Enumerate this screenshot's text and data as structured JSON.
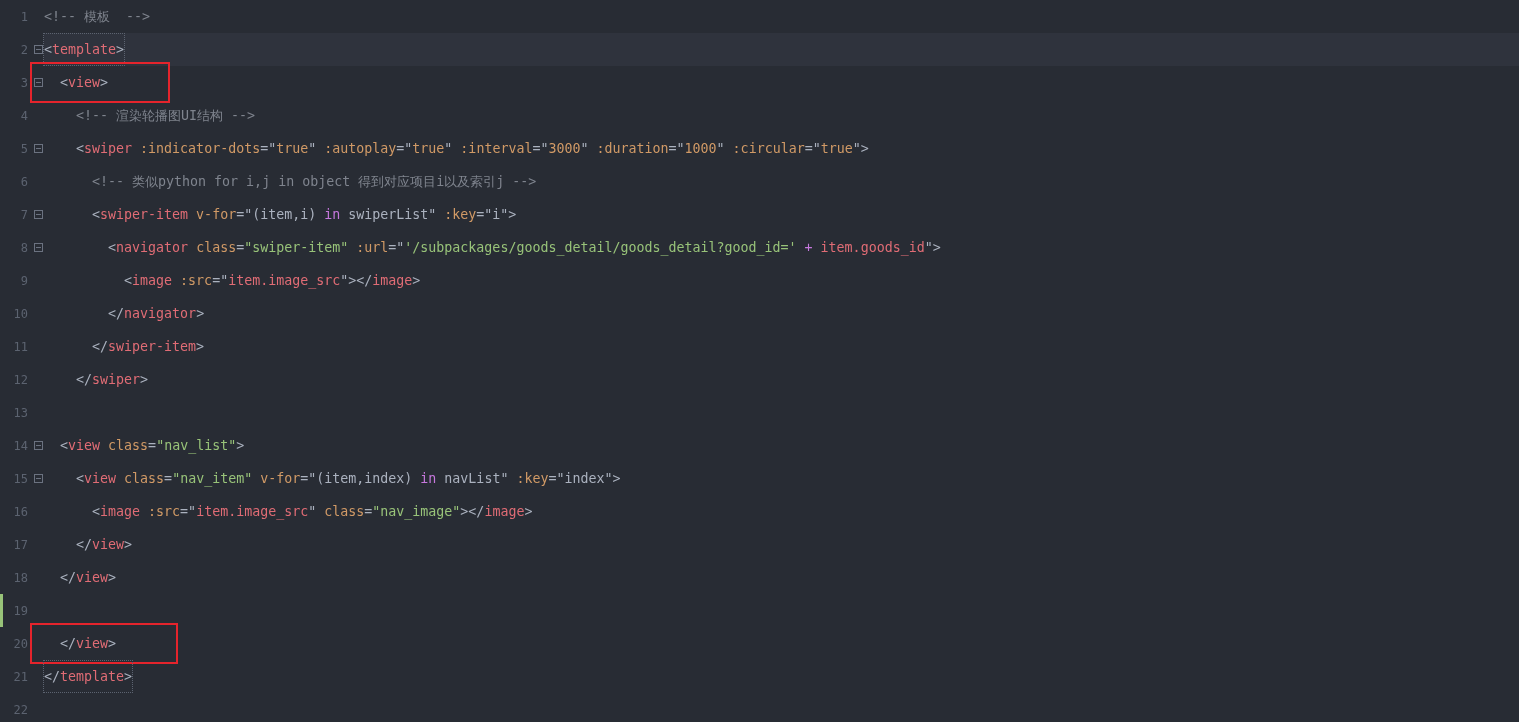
{
  "editor": {
    "lines": [
      {
        "number": "1",
        "foldable": false,
        "current": false,
        "modified": false,
        "highlighted": false,
        "bracket_match": false,
        "tokens": [
          {
            "kind": "cmt",
            "text": "<!-- 模板  -->"
          }
        ]
      },
      {
        "number": "2",
        "foldable": true,
        "current": true,
        "modified": false,
        "highlighted": false,
        "bracket_match": true,
        "tokens": [
          {
            "kind": "p",
            "text": "<"
          },
          {
            "kind": "tag",
            "text": "template"
          },
          {
            "kind": "p",
            "text": ">"
          }
        ]
      },
      {
        "number": "3",
        "foldable": true,
        "current": false,
        "modified": false,
        "highlighted": true,
        "bracket_match": false,
        "tokens": [
          {
            "kind": "p",
            "text": "  <"
          },
          {
            "kind": "tag",
            "text": "view"
          },
          {
            "kind": "p",
            "text": ">"
          }
        ]
      },
      {
        "number": "4",
        "foldable": false,
        "current": false,
        "modified": false,
        "highlighted": false,
        "bracket_match": false,
        "tokens": [
          {
            "kind": "cmt",
            "text": "    <!-- 渲染轮播图UI结构 -->"
          }
        ]
      },
      {
        "number": "5",
        "foldable": true,
        "current": false,
        "modified": false,
        "highlighted": false,
        "bracket_match": false,
        "tokens": [
          {
            "kind": "p",
            "text": "    <"
          },
          {
            "kind": "tag",
            "text": "swiper"
          },
          {
            "kind": "attr",
            "text": " :indicator-dots"
          },
          {
            "kind": "p",
            "text": "=\""
          },
          {
            "kind": "num",
            "text": "true"
          },
          {
            "kind": "p",
            "text": "\""
          },
          {
            "kind": "attr",
            "text": " :autoplay"
          },
          {
            "kind": "p",
            "text": "=\""
          },
          {
            "kind": "num",
            "text": "true"
          },
          {
            "kind": "p",
            "text": "\""
          },
          {
            "kind": "attr",
            "text": " :interval"
          },
          {
            "kind": "p",
            "text": "=\""
          },
          {
            "kind": "num",
            "text": "3000"
          },
          {
            "kind": "p",
            "text": "\""
          },
          {
            "kind": "attr",
            "text": " :duration"
          },
          {
            "kind": "p",
            "text": "=\""
          },
          {
            "kind": "num",
            "text": "1000"
          },
          {
            "kind": "p",
            "text": "\""
          },
          {
            "kind": "attr",
            "text": " :circular"
          },
          {
            "kind": "p",
            "text": "=\""
          },
          {
            "kind": "num",
            "text": "true"
          },
          {
            "kind": "p",
            "text": "\">"
          }
        ]
      },
      {
        "number": "6",
        "foldable": false,
        "current": false,
        "modified": false,
        "highlighted": false,
        "bracket_match": false,
        "tokens": [
          {
            "kind": "cmt",
            "text": "      <!-- 类似python for i,j in object 得到对应项目i以及索引j -->"
          }
        ]
      },
      {
        "number": "7",
        "foldable": true,
        "current": false,
        "modified": false,
        "highlighted": false,
        "bracket_match": false,
        "tokens": [
          {
            "kind": "p",
            "text": "      <"
          },
          {
            "kind": "tag",
            "text": "swiper-item"
          },
          {
            "kind": "attr",
            "text": " v-for"
          },
          {
            "kind": "p",
            "text": "=\"(item,i) "
          },
          {
            "kind": "kw",
            "text": "in"
          },
          {
            "kind": "txt",
            "text": " swiperList"
          },
          {
            "kind": "p",
            "text": "\""
          },
          {
            "kind": "attr",
            "text": " :key"
          },
          {
            "kind": "p",
            "text": "=\"i\">"
          }
        ]
      },
      {
        "number": "8",
        "foldable": true,
        "current": false,
        "modified": false,
        "highlighted": false,
        "bracket_match": false,
        "tokens": [
          {
            "kind": "p",
            "text": "        <"
          },
          {
            "kind": "tag",
            "text": "navigator"
          },
          {
            "kind": "attr",
            "text": " class"
          },
          {
            "kind": "p",
            "text": "="
          },
          {
            "kind": "str",
            "text": "\"swiper-item\""
          },
          {
            "kind": "attr",
            "text": " :url"
          },
          {
            "kind": "p",
            "text": "=\""
          },
          {
            "kind": "str",
            "text": "'/subpackages/goods_detail/goods_detail?good_id='"
          },
          {
            "kind": "kw",
            "text": " +"
          },
          {
            "kind": "var",
            "text": " item.goods_id"
          },
          {
            "kind": "p",
            "text": "\">"
          }
        ]
      },
      {
        "number": "9",
        "foldable": false,
        "current": false,
        "modified": false,
        "highlighted": false,
        "bracket_match": false,
        "tokens": [
          {
            "kind": "p",
            "text": "          <"
          },
          {
            "kind": "tag",
            "text": "image"
          },
          {
            "kind": "attr",
            "text": " :src"
          },
          {
            "kind": "p",
            "text": "=\""
          },
          {
            "kind": "var",
            "text": "item.image_src"
          },
          {
            "kind": "p",
            "text": "\"></"
          },
          {
            "kind": "tag",
            "text": "image"
          },
          {
            "kind": "p",
            "text": ">"
          }
        ]
      },
      {
        "number": "10",
        "foldable": false,
        "current": false,
        "modified": false,
        "highlighted": false,
        "bracket_match": false,
        "tokens": [
          {
            "kind": "p",
            "text": "        </"
          },
          {
            "kind": "tag",
            "text": "navigator"
          },
          {
            "kind": "p",
            "text": ">"
          }
        ]
      },
      {
        "number": "11",
        "foldable": false,
        "current": false,
        "modified": false,
        "highlighted": false,
        "bracket_match": false,
        "tokens": [
          {
            "kind": "p",
            "text": "      </"
          },
          {
            "kind": "tag",
            "text": "swiper-item"
          },
          {
            "kind": "p",
            "text": ">"
          }
        ]
      },
      {
        "number": "12",
        "foldable": false,
        "current": false,
        "modified": false,
        "highlighted": false,
        "bracket_match": false,
        "tokens": [
          {
            "kind": "p",
            "text": "    </"
          },
          {
            "kind": "tag",
            "text": "swiper"
          },
          {
            "kind": "p",
            "text": ">"
          }
        ]
      },
      {
        "number": "13",
        "foldable": false,
        "current": false,
        "modified": false,
        "highlighted": false,
        "bracket_match": false
      },
      {
        "number": "14",
        "foldable": true,
        "current": false,
        "modified": false,
        "highlighted": false,
        "bracket_match": false,
        "tokens": [
          {
            "kind": "p",
            "text": "  <"
          },
          {
            "kind": "tag",
            "text": "view"
          },
          {
            "kind": "attr",
            "text": " class"
          },
          {
            "kind": "p",
            "text": "="
          },
          {
            "kind": "str",
            "text": "\"nav_list\""
          },
          {
            "kind": "p",
            "text": ">"
          }
        ]
      },
      {
        "number": "15",
        "foldable": true,
        "current": false,
        "modified": false,
        "highlighted": false,
        "bracket_match": false,
        "tokens": [
          {
            "kind": "p",
            "text": "    <"
          },
          {
            "kind": "tag",
            "text": "view"
          },
          {
            "kind": "attr",
            "text": " class"
          },
          {
            "kind": "p",
            "text": "="
          },
          {
            "kind": "str",
            "text": "\"nav_item\""
          },
          {
            "kind": "attr",
            "text": " v-for"
          },
          {
            "kind": "p",
            "text": "=\"(item,index) "
          },
          {
            "kind": "kw",
            "text": "in"
          },
          {
            "kind": "txt",
            "text": " navList"
          },
          {
            "kind": "p",
            "text": "\""
          },
          {
            "kind": "attr",
            "text": " :key"
          },
          {
            "kind": "p",
            "text": "=\"index\">"
          }
        ]
      },
      {
        "number": "16",
        "foldable": false,
        "current": false,
        "modified": false,
        "highlighted": false,
        "bracket_match": false,
        "tokens": [
          {
            "kind": "p",
            "text": "      <"
          },
          {
            "kind": "tag",
            "text": "image"
          },
          {
            "kind": "attr",
            "text": " :src"
          },
          {
            "kind": "p",
            "text": "=\""
          },
          {
            "kind": "var",
            "text": "item.image_src"
          },
          {
            "kind": "p",
            "text": "\""
          },
          {
            "kind": "attr",
            "text": " class"
          },
          {
            "kind": "p",
            "text": "="
          },
          {
            "kind": "str",
            "text": "\"nav_image\""
          },
          {
            "kind": "p",
            "text": "></"
          },
          {
            "kind": "tag",
            "text": "image"
          },
          {
            "kind": "p",
            "text": ">"
          }
        ]
      },
      {
        "number": "17",
        "foldable": false,
        "current": false,
        "modified": false,
        "highlighted": false,
        "bracket_match": false,
        "tokens": [
          {
            "kind": "p",
            "text": "    </"
          },
          {
            "kind": "tag",
            "text": "view"
          },
          {
            "kind": "p",
            "text": ">"
          }
        ]
      },
      {
        "number": "18",
        "foldable": false,
        "current": false,
        "modified": false,
        "highlighted": false,
        "bracket_match": false,
        "tokens": [
          {
            "kind": "p",
            "text": "  </"
          },
          {
            "kind": "tag",
            "text": "view"
          },
          {
            "kind": "p",
            "text": ">"
          }
        ]
      },
      {
        "number": "19",
        "foldable": false,
        "current": false,
        "modified": true,
        "highlighted": false,
        "bracket_match": false
      },
      {
        "number": "20",
        "foldable": false,
        "current": false,
        "modified": false,
        "highlighted": true,
        "bracket_match": false,
        "tokens": [
          {
            "kind": "p",
            "text": "  </"
          },
          {
            "kind": "tag",
            "text": "view"
          },
          {
            "kind": "p",
            "text": ">"
          }
        ]
      },
      {
        "number": "21",
        "foldable": false,
        "current": false,
        "modified": false,
        "highlighted": false,
        "bracket_match": true,
        "tokens": [
          {
            "kind": "p",
            "text": "</"
          },
          {
            "kind": "tag",
            "text": "template"
          },
          {
            "kind": "p",
            "text": ">"
          }
        ]
      },
      {
        "number": "22",
        "foldable": false,
        "current": false,
        "modified": false,
        "highlighted": false,
        "bracket_match": false
      }
    ]
  }
}
